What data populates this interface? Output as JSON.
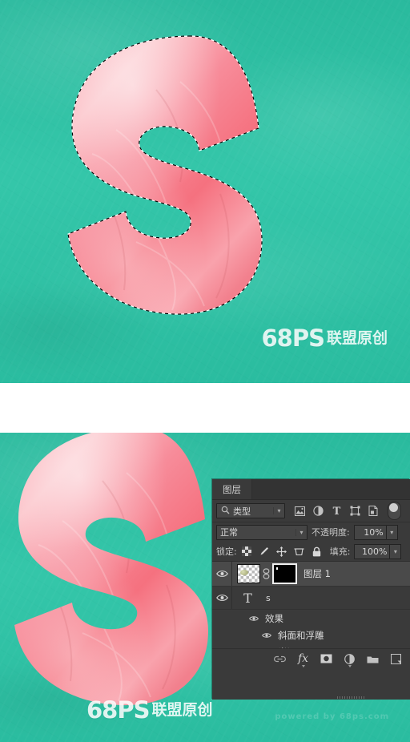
{
  "canvas": {
    "background_color": "#2cc4a6",
    "letter": "S",
    "letter_color_light": "#fcb5bd",
    "letter_color_dark": "#f4717f",
    "selection_note": "marching-ants selection around letter"
  },
  "watermark": {
    "logo": "68PS",
    "text": "联盟原创",
    "ghost": "powered by 68ps.com"
  },
  "panel": {
    "tab_label": "图层",
    "filter": {
      "search_icon": "magnifier-icon",
      "kind_label": "类型",
      "icons": [
        {
          "name": "pixel-layer-filter-icon",
          "label": "像素图层"
        },
        {
          "name": "adjustment-layer-filter-icon",
          "label": "调整图层"
        },
        {
          "name": "type-layer-filter-icon",
          "label": "文字图层"
        },
        {
          "name": "shape-layer-filter-icon",
          "label": "形状图层"
        },
        {
          "name": "smart-object-filter-icon",
          "label": "智能对象"
        }
      ],
      "toggle_name": "filter-enable-toggle"
    },
    "blend": {
      "mode_label": "正常",
      "opacity_label": "不透明度:",
      "opacity_value": "10%"
    },
    "lock": {
      "lock_label": "锁定:",
      "icons": [
        {
          "name": "lock-transparent-pixels-icon"
        },
        {
          "name": "lock-image-pixels-icon"
        },
        {
          "name": "lock-position-icon"
        },
        {
          "name": "lock-artboard-nesting-icon"
        },
        {
          "name": "lock-all-icon"
        }
      ],
      "fill_label": "填充:",
      "fill_value": "100%"
    },
    "layers": [
      {
        "name": "图层 1",
        "type": "pixel-with-mask",
        "selected": true,
        "visible": true,
        "link_icon": "link-icon",
        "mask": "black-layer-mask"
      },
      {
        "name": "s",
        "type": "text",
        "selected": false,
        "visible": true,
        "type_icon": "T",
        "effects": {
          "label": "效果",
          "items": [
            "斜面和浮雕",
            "光泽"
          ]
        }
      }
    ],
    "bottom_bar": [
      {
        "name": "link-layers-icon",
        "label": "链接图层"
      },
      {
        "name": "layer-style-fx-icon",
        "label": "fx"
      },
      {
        "name": "add-layer-mask-icon",
        "label": "添加图层蒙版"
      },
      {
        "name": "new-adjustment-layer-icon",
        "label": "创建新的填充或调整图层"
      },
      {
        "name": "new-group-icon",
        "label": "创建新组"
      },
      {
        "name": "new-layer-icon",
        "label": "创建新图层"
      }
    ]
  }
}
